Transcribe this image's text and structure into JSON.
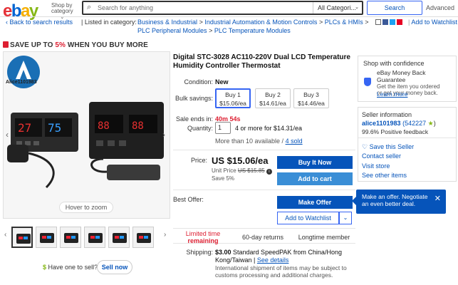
{
  "header": {
    "logo": {
      "e": "e",
      "b": "b",
      "a": "a",
      "y": "y"
    },
    "shop_by_line1": "Shop by",
    "shop_by_line2": "category",
    "search_placeholder": "Search for anything",
    "category_selected": "All Categori...",
    "search_button": "Search",
    "advanced": "Advanced"
  },
  "breadcrumb": {
    "back": "Back to search results",
    "listed_in": "| Listed in category:",
    "items_line1": [
      "Business & Industrial",
      "Industrial Automation & Motion Controls",
      "PLCs & HMIs"
    ],
    "items_line2": [
      "PLC Peripheral Modules",
      "PLC Temperature Modules"
    ],
    "separator": ">",
    "add_to_watchlist": "Add to Watchlist"
  },
  "banner": {
    "prefix": "SAVE UP TO ",
    "percent": "5%",
    "suffix": " WHEN YOU BUY MORE"
  },
  "gallery": {
    "seller_badge": "Alice1101983",
    "hover_to_zoom": "Hover to zoom",
    "thumb_count": 7
  },
  "sell": {
    "prefix": "$",
    "question": "Have one to sell?",
    "sell_now": "Sell now"
  },
  "item": {
    "title": "Digital STC-3028 AC110-220V Dual LCD Temperature Humidity Controller Thermostat",
    "condition_label": "Condition:",
    "condition_value": "New",
    "bulk_label": "Bulk savings:",
    "bulk_options": [
      {
        "name": "Buy 1",
        "price": "$15.06/ea",
        "selected": true
      },
      {
        "name": "Buy 2",
        "price": "$14.61/ea",
        "selected": false
      },
      {
        "name": "Buy 3",
        "price": "$14.46/ea",
        "selected": false
      }
    ],
    "sale_ends_label": "Sale ends in:",
    "sale_ends_value": "40m 54s",
    "quantity_label": "Quantity:",
    "quantity_value": "1",
    "quantity_offer": "4 or more for $14.31/ea",
    "availability": "More than 10 available /",
    "sold": "4 sold",
    "price_label": "Price:",
    "price": "US $15.06/ea",
    "unit_price_prefix": "Unit Price",
    "unit_price_old": "US $15.85",
    "save_text": "Save 5%",
    "buy_it_now": "Buy It Now",
    "add_to_cart": "Add to cart",
    "best_offer_label": "Best Offer:",
    "make_offer": "Make Offer",
    "add_to_watchlist": "Add to Watchlist",
    "tooltip": "Make an offer. Negotiate an even better deal.",
    "features": {
      "limited_line1": "Limited time",
      "limited_line2": "remaining",
      "returns": "60-day returns",
      "longtime": "Longtime member"
    },
    "shipping_label": "Shipping:",
    "shipping_price": "$3.00",
    "shipping_text_1": " Standard SpeedPAK from China/Hong",
    "shipping_text_2": "Kong/Taiwan |",
    "see_details": "See details",
    "shipping_note": "International shipment of items may be subject to customs processing and additional charges."
  },
  "confidence": {
    "title": "Shop with confidence",
    "guarantee_title_1": "eBay Money Back",
    "guarantee_title_2": "Guarantee",
    "guarantee_desc_1": "Get the item you ordered",
    "guarantee_desc_2": "or get your money back.",
    "learn_more": "Learn more"
  },
  "seller": {
    "title": "Seller information",
    "name": "alice1101983",
    "feedback": "(542227",
    "feedback_end": ")",
    "positive": "99.6% Positive feedback",
    "save_seller": "Save this Seller",
    "contact": "Contact seller",
    "visit_store": "Visit store",
    "other_items": "See other items"
  },
  "colors": {
    "accent": "#0654ba",
    "cta": "#3665f3",
    "sale_red": "#dd1e31"
  }
}
